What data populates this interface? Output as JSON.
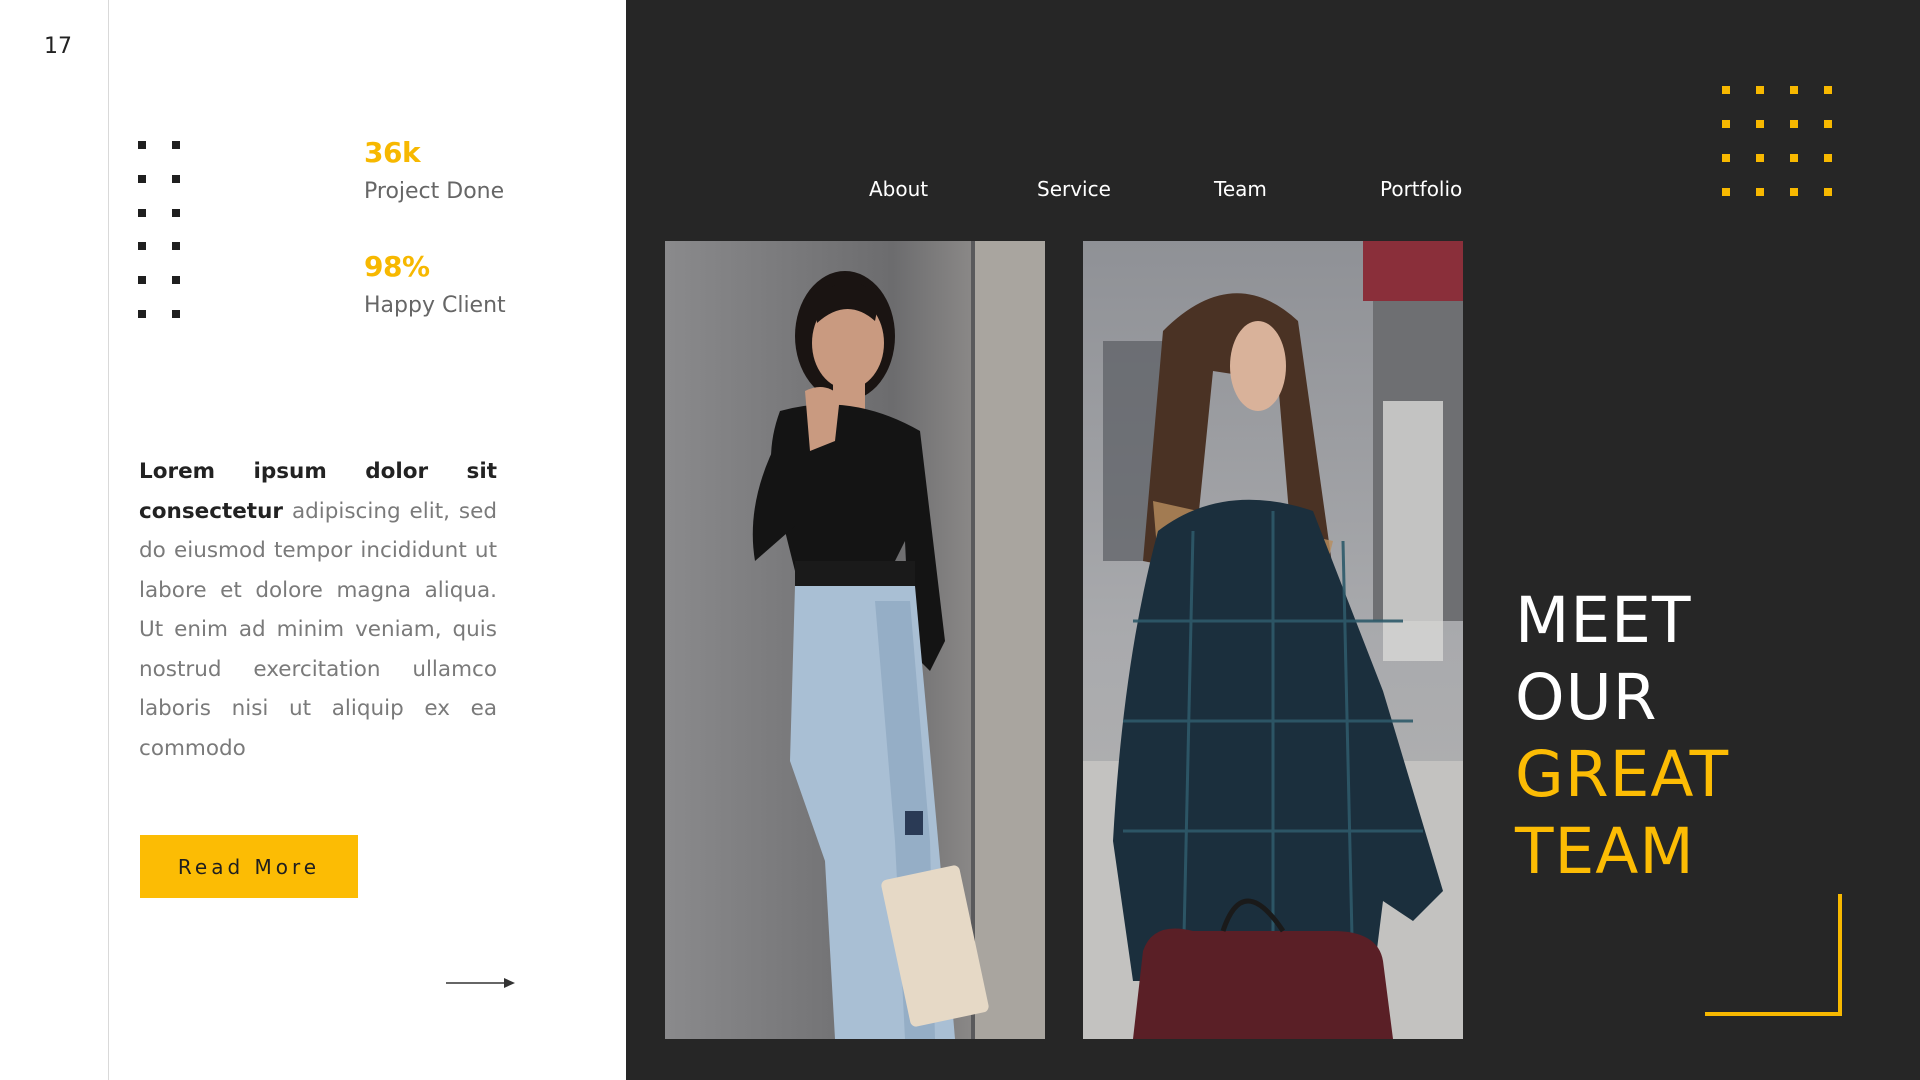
{
  "slide": {
    "page_number": "17"
  },
  "stats": [
    {
      "value": "36k",
      "label": "Project Done"
    },
    {
      "value": "98%",
      "label": "Happy Client"
    }
  ],
  "body_text": {
    "lead": "Lorem ipsum dolor sit consectetur",
    "rest": "adipiscing elit, sed do eiusmod tempor incididunt ut labore et dolore magna aliqua. Ut enim ad minim veniam, quis nostrud exercitation ullamco laboris nisi ut aliquip ex ea commodo"
  },
  "cta": {
    "label": "Read More"
  },
  "nav": {
    "items": [
      "About",
      "Service",
      "Team",
      "Portfolio"
    ]
  },
  "headline": {
    "line1": "MEET",
    "line2": "OUR",
    "line3": "GREAT",
    "line4": "TEAM"
  },
  "colors": {
    "accent": "#fcbc04",
    "dark_panel": "#262626"
  },
  "icons": {
    "arrow": "arrow-right-icon"
  }
}
